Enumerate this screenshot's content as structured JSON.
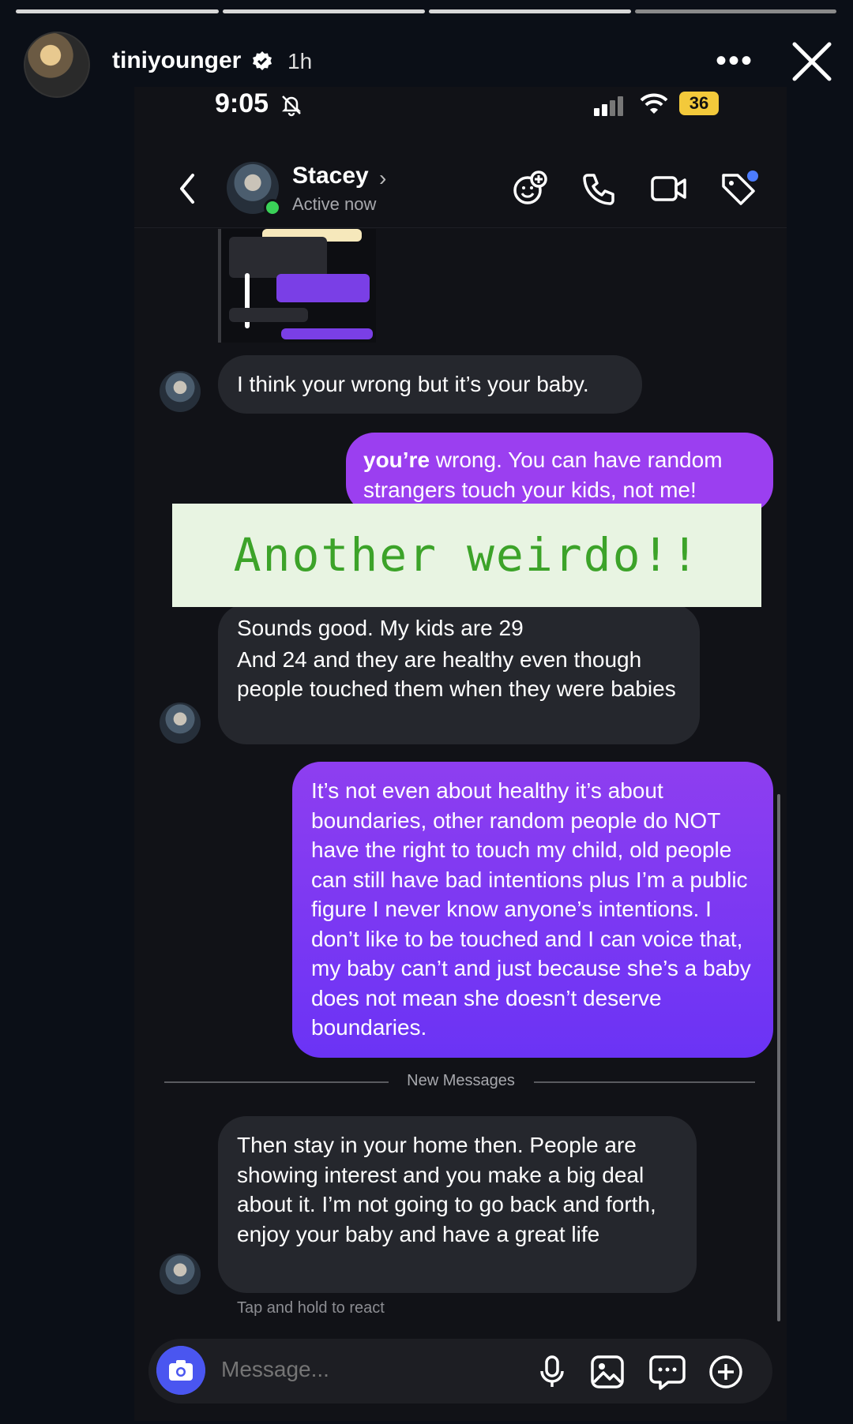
{
  "story": {
    "username": "tiniyounger",
    "time": "1h",
    "progress_segments": 4,
    "current_segment": 4
  },
  "status_bar": {
    "time": "9:05",
    "battery": "36"
  },
  "chat_header": {
    "contact_name": "Stacey",
    "status": "Active now"
  },
  "messages": [
    {
      "from": "them",
      "text": "I think your wrong but it’s your baby."
    },
    {
      "from": "me",
      "bold_prefix": "you’re",
      "text": " wrong. You can have random strangers touch your kids, not me!"
    },
    {
      "from": "them",
      "lines": [
        "Sounds good.  My kids are 29",
        "And 24 and they are healthy even though people touched them when they were babies"
      ]
    },
    {
      "from": "me",
      "text": "It’s not even about healthy it’s about boundaries, other random people do NOT have the right to touch my child, old people can still have bad intentions plus I’m a public figure I never know anyone’s intentions. I don’t like to be touched and I can voice that, my baby can’t and just because she’s a baby does not mean she doesn’t deserve boundaries."
    },
    {
      "from": "them",
      "text": "Then stay in your home then.  People are showing interest and you make a big deal about it.  I’m not going to go back and forth, enjoy your baby and have a great life"
    }
  ],
  "sticker_text": "Another weirdo!!",
  "divider_label": "New Messages",
  "react_hint": "Tap and hold to react",
  "composer": {
    "placeholder": "Message..."
  },
  "colors": {
    "outgoing_bubble": "#7b36f2",
    "incoming_bubble": "#25272d",
    "sticker_bg": "#e8f4e2",
    "sticker_text": "#3ca329",
    "camera_button": "#4a56f0"
  },
  "icons": [
    "verified-icon",
    "more-icon",
    "close-icon",
    "back-icon",
    "effects-icon",
    "phone-icon",
    "video-icon",
    "tag-icon",
    "camera-icon",
    "mic-icon",
    "image-icon",
    "sticker-icon",
    "plus-icon"
  ]
}
